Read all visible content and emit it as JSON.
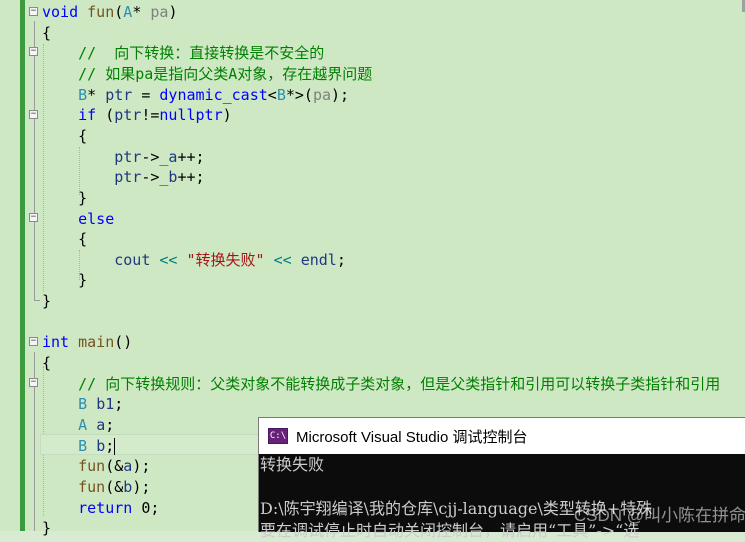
{
  "code_lines": [
    {
      "parts": [
        [
          "kw",
          "void "
        ],
        [
          "fn",
          "fun"
        ],
        [
          "",
          "("
        ],
        [
          "ty",
          "A"
        ],
        [
          "",
          "* "
        ],
        [
          "pm",
          "pa"
        ],
        [
          "",
          ")"
        ]
      ]
    },
    {
      "parts": [
        [
          "",
          "{"
        ]
      ]
    },
    {
      "parts": [
        [
          "cm",
          "    //  向下转换：直接转换是不安全的"
        ]
      ]
    },
    {
      "parts": [
        [
          "cm",
          "    // 如果pa是指向父类A对象，存在越界问题"
        ]
      ]
    },
    {
      "parts": [
        [
          "ty",
          "    B"
        ],
        [
          "",
          "* "
        ],
        [
          "var",
          "ptr"
        ],
        [
          "",
          " = "
        ],
        [
          "kw",
          "dynamic_cast"
        ],
        [
          "",
          "<"
        ],
        [
          "ty",
          "B"
        ],
        [
          "",
          "*>("
        ],
        [
          "pm",
          "pa"
        ],
        [
          "",
          ");"
        ]
      ]
    },
    {
      "parts": [
        [
          "kw",
          "    if"
        ],
        [
          "",
          " ("
        ],
        [
          "var",
          "ptr"
        ],
        [
          "",
          "!="
        ],
        [
          "kw",
          "nullptr"
        ],
        [
          "",
          ")"
        ]
      ]
    },
    {
      "parts": [
        [
          "",
          "    {"
        ]
      ]
    },
    {
      "parts": [
        [
          "var",
          "        ptr"
        ],
        [
          "",
          "->"
        ],
        [
          "var",
          "_a"
        ],
        [
          "",
          "++;"
        ]
      ]
    },
    {
      "parts": [
        [
          "var",
          "        ptr"
        ],
        [
          "",
          "->"
        ],
        [
          "var",
          "_b"
        ],
        [
          "",
          "++;"
        ]
      ]
    },
    {
      "parts": [
        [
          "",
          "    }"
        ]
      ]
    },
    {
      "parts": [
        [
          "kw",
          "    else"
        ]
      ]
    },
    {
      "parts": [
        [
          "",
          "    {"
        ]
      ]
    },
    {
      "parts": [
        [
          "var",
          "        cout"
        ],
        [
          "",
          " "
        ],
        [
          "op",
          "<<"
        ],
        [
          "",
          " "
        ],
        [
          "str",
          "\"转换失败\""
        ],
        [
          "",
          " "
        ],
        [
          "op",
          "<<"
        ],
        [
          "",
          " "
        ],
        [
          "var",
          "endl"
        ],
        [
          "",
          ";"
        ]
      ]
    },
    {
      "parts": [
        [
          "",
          "    }"
        ]
      ]
    },
    {
      "parts": [
        [
          "",
          "}"
        ]
      ]
    },
    {
      "parts": []
    },
    {
      "parts": [
        [
          "kw",
          "int "
        ],
        [
          "fn",
          "main"
        ],
        [
          "",
          "()"
        ]
      ]
    },
    {
      "parts": [
        [
          "",
          "{"
        ]
      ]
    },
    {
      "parts": [
        [
          "cm",
          "    // 向下转换规则：父类对象不能转换成子类对象，但是父类指针和引用可以转换子类指针和引用"
        ]
      ]
    },
    {
      "parts": [
        [
          "ty",
          "    B "
        ],
        [
          "var",
          "b1"
        ],
        [
          "",
          ";"
        ]
      ]
    },
    {
      "parts": [
        [
          "ty",
          "    A "
        ],
        [
          "var",
          "a"
        ],
        [
          "",
          ";"
        ]
      ]
    },
    {
      "parts": [
        [
          "ty",
          "    B "
        ],
        [
          "var",
          "b"
        ],
        [
          "",
          ";"
        ]
      ]
    },
    {
      "parts": [
        [
          "fn",
          "    fun"
        ],
        [
          "",
          "(&"
        ],
        [
          "var",
          "a"
        ],
        [
          "",
          ");"
        ]
      ]
    },
    {
      "parts": [
        [
          "fn",
          "    fun"
        ],
        [
          "",
          "(&"
        ],
        [
          "var",
          "b"
        ],
        [
          "",
          ");"
        ]
      ]
    },
    {
      "parts": [
        [
          "kw",
          "    return "
        ],
        [
          "",
          "0;"
        ]
      ]
    },
    {
      "parts": [
        [
          "",
          "}"
        ]
      ]
    }
  ],
  "console": {
    "title": "Microsoft Visual Studio 调试控制台",
    "icon_text": "C:\\",
    "lines": [
      "转换失败",
      "",
      "D:\\陈宇翔编译\\我的仓库\\cjj-language\\类型转换+特殊",
      "要在调试停止时自动关闭控制台，请启用“工具”->“选"
    ]
  },
  "watermark": "CSDN @叫小陈在拼命"
}
